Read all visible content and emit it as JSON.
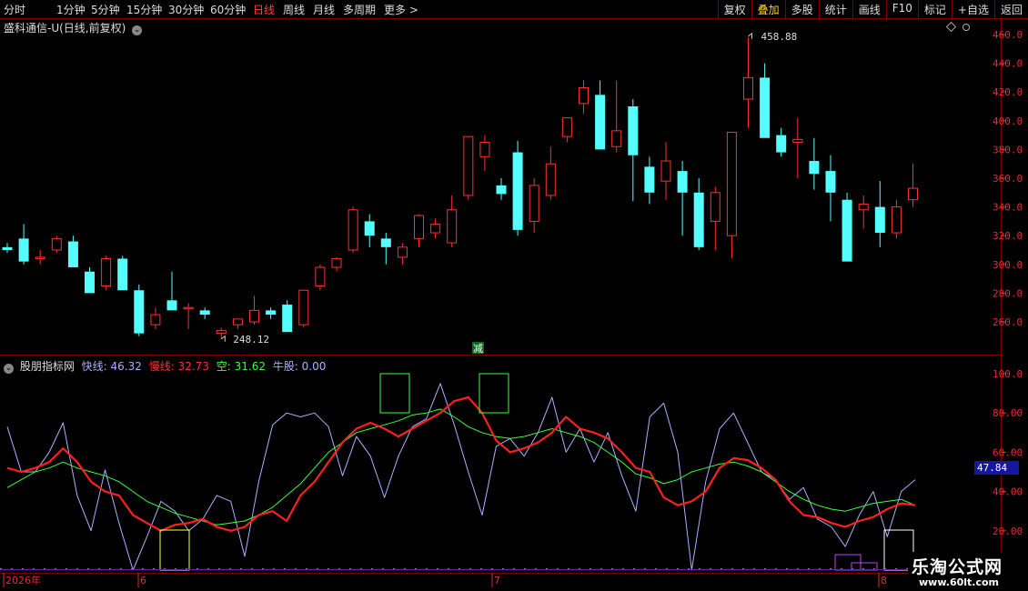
{
  "toolbar": {
    "periods": [
      {
        "label": "分时"
      },
      {
        "label": "1分钟"
      },
      {
        "label": "5分钟"
      },
      {
        "label": "15分钟"
      },
      {
        "label": "30分钟"
      },
      {
        "label": "60分钟"
      },
      {
        "label": "日线",
        "active": true
      },
      {
        "label": "周线"
      },
      {
        "label": "月线"
      },
      {
        "label": "多周期"
      },
      {
        "label": "更多 >"
      }
    ],
    "right_buttons": [
      {
        "label": "复权"
      },
      {
        "label": "叠加",
        "highlight": true
      },
      {
        "label": "多股"
      },
      {
        "label": "统计"
      },
      {
        "label": "画线"
      },
      {
        "label": "F10"
      },
      {
        "label": "标记"
      },
      {
        "label": "+自选"
      },
      {
        "label": "返回"
      }
    ]
  },
  "main_chart": {
    "title": "盛科通信-U(日线,前复权)",
    "y_ticks": [
      "460.0",
      "440.0",
      "420.0",
      "400.0",
      "380.0",
      "360.0",
      "340.0",
      "320.0",
      "300.0",
      "280.0",
      "260.0"
    ],
    "y_range": [
      248,
      465
    ],
    "high_marker": "458.88",
    "low_marker": "248.12",
    "signal_text": "减",
    "colors": {
      "up": "#ff3030",
      "down": "#54ffff",
      "frame": "#7a0000"
    },
    "candles": [
      [
        312,
        315,
        308,
        310
      ],
      [
        318,
        328,
        300,
        302
      ],
      [
        305,
        310,
        300,
        305
      ],
      [
        310,
        320,
        308,
        318
      ],
      [
        316,
        320,
        300,
        298
      ],
      [
        295,
        298,
        285,
        280
      ],
      [
        285,
        306,
        282,
        304
      ],
      [
        304,
        306,
        285,
        282
      ],
      [
        282,
        286,
        250,
        252
      ],
      [
        258,
        270,
        255,
        265
      ],
      [
        275,
        295,
        270,
        268
      ],
      [
        270,
        273,
        255,
        270
      ],
      [
        268,
        270,
        262,
        265
      ],
      [
        252,
        256,
        248,
        254
      ],
      [
        258,
        262,
        255,
        262
      ],
      [
        260,
        278,
        258,
        268
      ],
      [
        268,
        270,
        262,
        265
      ],
      [
        272,
        275,
        253,
        253
      ],
      [
        258,
        282,
        256,
        282
      ],
      [
        285,
        300,
        282,
        298
      ],
      [
        298,
        305,
        295,
        304
      ],
      [
        310,
        340,
        308,
        338
      ],
      [
        330,
        335,
        312,
        320
      ],
      [
        318,
        322,
        300,
        312
      ],
      [
        305,
        315,
        300,
        312
      ],
      [
        318,
        335,
        312,
        334
      ],
      [
        322,
        332,
        318,
        328
      ],
      [
        315,
        348,
        312,
        338
      ],
      [
        348,
        382,
        345,
        389
      ],
      [
        375,
        390,
        365,
        385
      ],
      [
        355,
        360,
        345,
        349
      ],
      [
        378,
        386,
        320,
        324
      ],
      [
        330,
        360,
        322,
        355
      ],
      [
        348,
        382,
        345,
        370
      ],
      [
        389,
        402,
        385,
        402
      ],
      [
        412,
        428,
        405,
        423
      ],
      [
        418,
        428,
        380,
        380
      ],
      [
        382,
        428,
        378,
        393
      ],
      [
        410,
        415,
        344,
        376
      ],
      [
        368,
        375,
        342,
        350
      ],
      [
        358,
        385,
        345,
        372
      ],
      [
        365,
        372,
        320,
        350
      ],
      [
        350,
        360,
        310,
        312
      ],
      [
        330,
        354,
        310,
        350
      ],
      [
        320,
        385,
        304,
        392
      ],
      [
        415,
        458,
        395,
        430
      ],
      [
        430,
        440,
        393,
        388
      ],
      [
        390,
        395,
        375,
        378
      ],
      [
        385,
        402,
        360,
        387
      ],
      [
        372,
        388,
        352,
        363
      ],
      [
        365,
        376,
        330,
        350
      ],
      [
        345,
        350,
        303,
        302
      ],
      [
        338,
        348,
        325,
        342
      ],
      [
        340,
        358,
        312,
        322
      ],
      [
        322,
        345,
        318,
        340
      ],
      [
        345,
        370,
        340,
        353
      ]
    ]
  },
  "indicator": {
    "title": "股朋指标网",
    "legend": [
      {
        "label": "快线: 46.32",
        "color": "#aab0ff"
      },
      {
        "label": "慢线: 32.73",
        "color": "#ff3030"
      },
      {
        "label": "空: 31.62",
        "color": "#39ff39"
      },
      {
        "label": "牛股: 0.00",
        "color": "#aab0ff"
      }
    ],
    "y_ticks": [
      "100.0",
      "80.00",
      "60.00",
      "40.00",
      "20.00"
    ],
    "y_range": [
      0,
      105
    ],
    "cursor_value": "47.84",
    "fast": [
      73,
      50,
      50,
      60,
      75,
      38,
      20,
      51,
      24,
      0,
      17,
      35,
      30,
      20,
      26,
      38,
      35,
      7,
      45,
      74,
      80,
      78,
      80,
      73,
      48,
      68,
      58,
      37,
      58,
      73,
      77,
      95,
      74,
      50,
      28,
      63,
      67,
      58,
      70,
      88,
      60,
      72,
      55,
      70,
      48,
      30,
      78,
      85,
      60,
      0,
      45,
      72,
      80,
      65,
      50,
      46,
      36,
      42,
      26,
      22,
      12,
      28,
      40,
      17,
      40,
      46
    ],
    "slow": [
      52,
      50,
      52,
      55,
      62,
      55,
      45,
      40,
      38,
      28,
      24,
      20,
      23,
      24,
      26,
      22,
      20,
      22,
      28,
      30,
      25,
      38,
      45,
      55,
      65,
      72,
      75,
      72,
      68,
      72,
      76,
      80,
      86,
      88,
      80,
      66,
      60,
      62,
      65,
      70,
      78,
      72,
      70,
      67,
      60,
      52,
      50,
      37,
      33,
      35,
      40,
      52,
      57,
      56,
      52,
      46,
      35,
      28,
      27,
      24,
      22,
      25,
      27,
      31,
      34,
      33
    ],
    "empty": [
      42,
      46,
      50,
      52,
      55,
      52,
      50,
      48,
      45,
      40,
      35,
      32,
      29,
      27,
      25,
      23,
      24,
      25,
      28,
      32,
      38,
      44,
      52,
      60,
      65,
      70,
      72,
      74,
      76,
      79,
      80,
      82,
      78,
      73,
      70,
      68,
      67,
      68,
      70,
      72,
      70,
      68,
      65,
      60,
      55,
      49,
      47,
      44,
      46,
      50,
      52,
      54,
      55,
      53,
      50,
      45,
      40,
      36,
      33,
      31,
      30,
      32,
      34,
      35,
      36,
      33
    ],
    "colors": {
      "fast": "#aab0ff",
      "slow": "#ff2020",
      "empty": "#39ff39",
      "bull": "#9a5cff"
    }
  },
  "x_axis": {
    "labels": [
      "2026年",
      "6",
      "7",
      "8"
    ]
  },
  "watermark": {
    "name": "乐淘公式网",
    "url": "www.60lt.com"
  }
}
